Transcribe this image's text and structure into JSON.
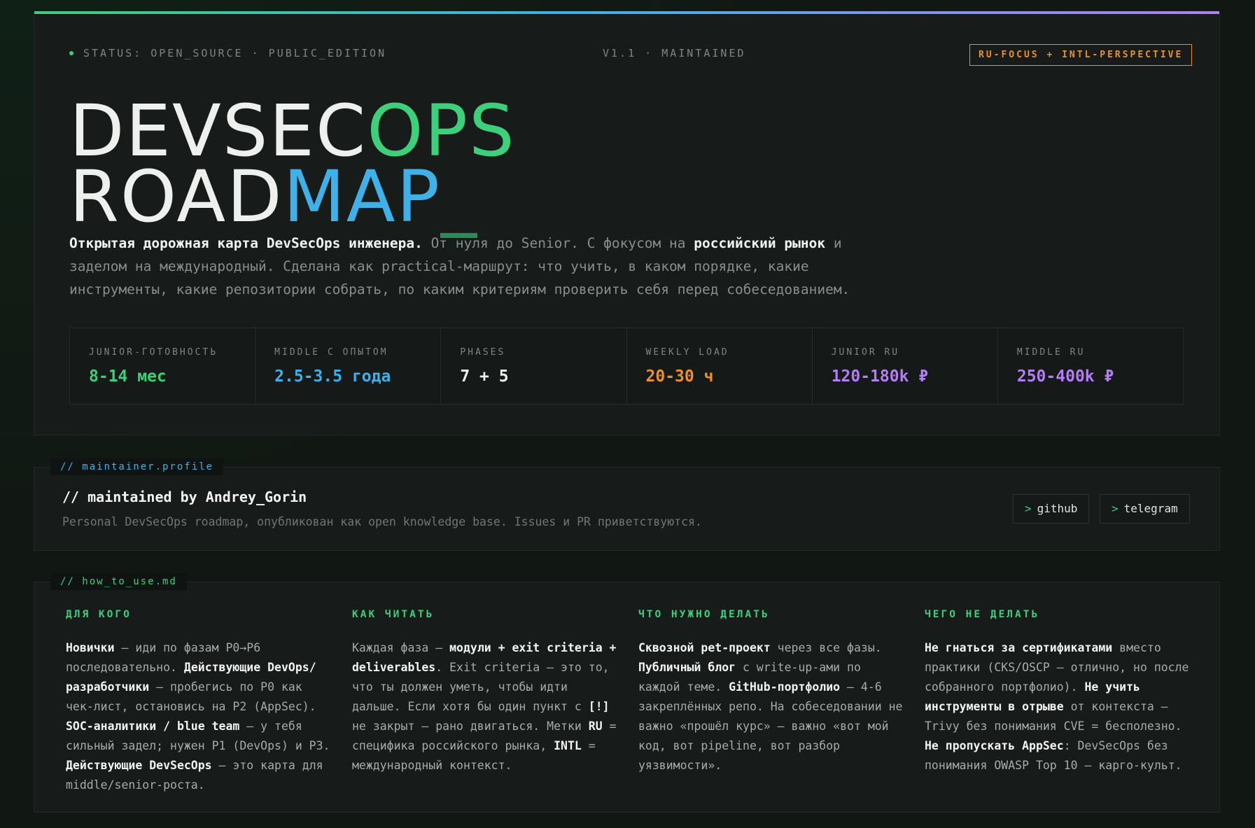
{
  "header": {
    "status": "STATUS: OPEN_SOURCE · PUBLIC_EDITION",
    "version": "V1.1 · MAINTAINED",
    "badge": "RU-FOCUS + INTL-PERSPECTIVE",
    "title": {
      "line1_white": "DEVSEC",
      "line1_green": "OPS",
      "line2_white": "ROAD",
      "line2_blue": "MAP",
      "cursor": "_"
    },
    "description": {
      "p1": "Открытая дорожная карта DevSecOps инженера.",
      "p2": " От нуля до Senior. С фокусом на ",
      "p3": "российский рынок",
      "p4": " и заделом на международный. Сделана как practical-маршрут: что учить, в каком порядке, какие инструменты, какие репозитории собрать, по каким критериям проверить себя перед собеседованием."
    }
  },
  "stats": [
    {
      "label": "JUNIOR-ГОТОВНОСТЬ",
      "value": "8-14 мес",
      "color": "#3ecf7a"
    },
    {
      "label": "MIDDLE С ОПЫТОМ",
      "value": "2.5-3.5 года",
      "color": "#3fb0e8"
    },
    {
      "label": "PHASES",
      "value": "7 + 5",
      "color": "#eef0ee"
    },
    {
      "label": "WEEKLY LOAD",
      "value": "20-30 ч",
      "color": "#e8912d"
    },
    {
      "label": "JUNIOR RU",
      "value": "120-180k ₽",
      "color": "#b37ff0"
    },
    {
      "label": "MIDDLE RU",
      "value": "250-400k ₽",
      "color": "#b37ff0"
    }
  ],
  "profile": {
    "tag": "// maintainer.profile",
    "title": "// maintained by Andrey_Gorin",
    "description": "Personal DevSecOps roadmap, опубликован как open knowledge base. Issues и PR приветствуются.",
    "links": [
      {
        "prefix": ">",
        "label": "github"
      },
      {
        "prefix": ">",
        "label": "telegram"
      }
    ]
  },
  "howto": {
    "tag": "// how_to_use.md",
    "columns": [
      {
        "heading": "ДЛЯ КОГО",
        "parts": [
          {
            "b": true,
            "t": "Новички"
          },
          {
            "b": false,
            "t": " — иди по фазам P0→P6 последовательно. "
          },
          {
            "b": true,
            "t": "Действующие DevOps/ разработчики"
          },
          {
            "b": false,
            "t": " — пробегись по P0 как чек-лист, остановись на P2 (AppSec). "
          },
          {
            "b": true,
            "t": "SOC-аналитики / blue team"
          },
          {
            "b": false,
            "t": " — у тебя сильный задел; нужен P1 (DevOps) и P3. "
          },
          {
            "b": true,
            "t": "Действующие DevSecOps"
          },
          {
            "b": false,
            "t": " — это карта для middle/senior-роста."
          }
        ]
      },
      {
        "heading": "КАК ЧИТАТЬ",
        "parts": [
          {
            "b": false,
            "t": "Каждая фаза — "
          },
          {
            "b": true,
            "t": "модули + exit criteria + deliverables"
          },
          {
            "b": false,
            "t": ". Exit criteria — это то, что ты должен уметь, чтобы идти дальше. Если хотя бы один пункт с "
          },
          {
            "b": true,
            "t": "[!]"
          },
          {
            "b": false,
            "t": " не закрыт — рано двигаться. Метки "
          },
          {
            "b": true,
            "t": "RU"
          },
          {
            "b": false,
            "t": " = специфика российского рынка, "
          },
          {
            "b": true,
            "t": "INTL"
          },
          {
            "b": false,
            "t": " = международный контекст."
          }
        ]
      },
      {
        "heading": "ЧТО НУЖНО ДЕЛАТЬ",
        "parts": [
          {
            "b": true,
            "t": "Сквозной pet-проект"
          },
          {
            "b": false,
            "t": " через все фазы. "
          },
          {
            "b": true,
            "t": "Публичный блог"
          },
          {
            "b": false,
            "t": " с write-up-ами по каждой теме. "
          },
          {
            "b": true,
            "t": "GitHub-портфолио"
          },
          {
            "b": false,
            "t": " — 4-6 закреплённых репо. На собеседовании не важно «прошёл курс» — важно «вот мой код, вот pipeline, вот разбор уязвимости»."
          }
        ]
      },
      {
        "heading": "ЧЕГО НЕ ДЕЛАТЬ",
        "parts": [
          {
            "b": true,
            "t": "Не гнаться за сертификатами"
          },
          {
            "b": false,
            "t": " вместо практики (CKS/OSCP — отлично, но после собранного портфолио). "
          },
          {
            "b": true,
            "t": "Не учить инструменты в отрыве"
          },
          {
            "b": false,
            "t": " от контекста — Trivy без понимания CVE = бесполезно. "
          },
          {
            "b": true,
            "t": "Не пропускать AppSec"
          },
          {
            "b": false,
            "t": ": DevSecOps без понимания OWASP Top 10 — карго-культ."
          }
        ]
      }
    ]
  },
  "colors": {
    "green": "#3ecf7a",
    "blue": "#3fb0e8",
    "orange": "#e8912d",
    "purple": "#b37ff0"
  }
}
